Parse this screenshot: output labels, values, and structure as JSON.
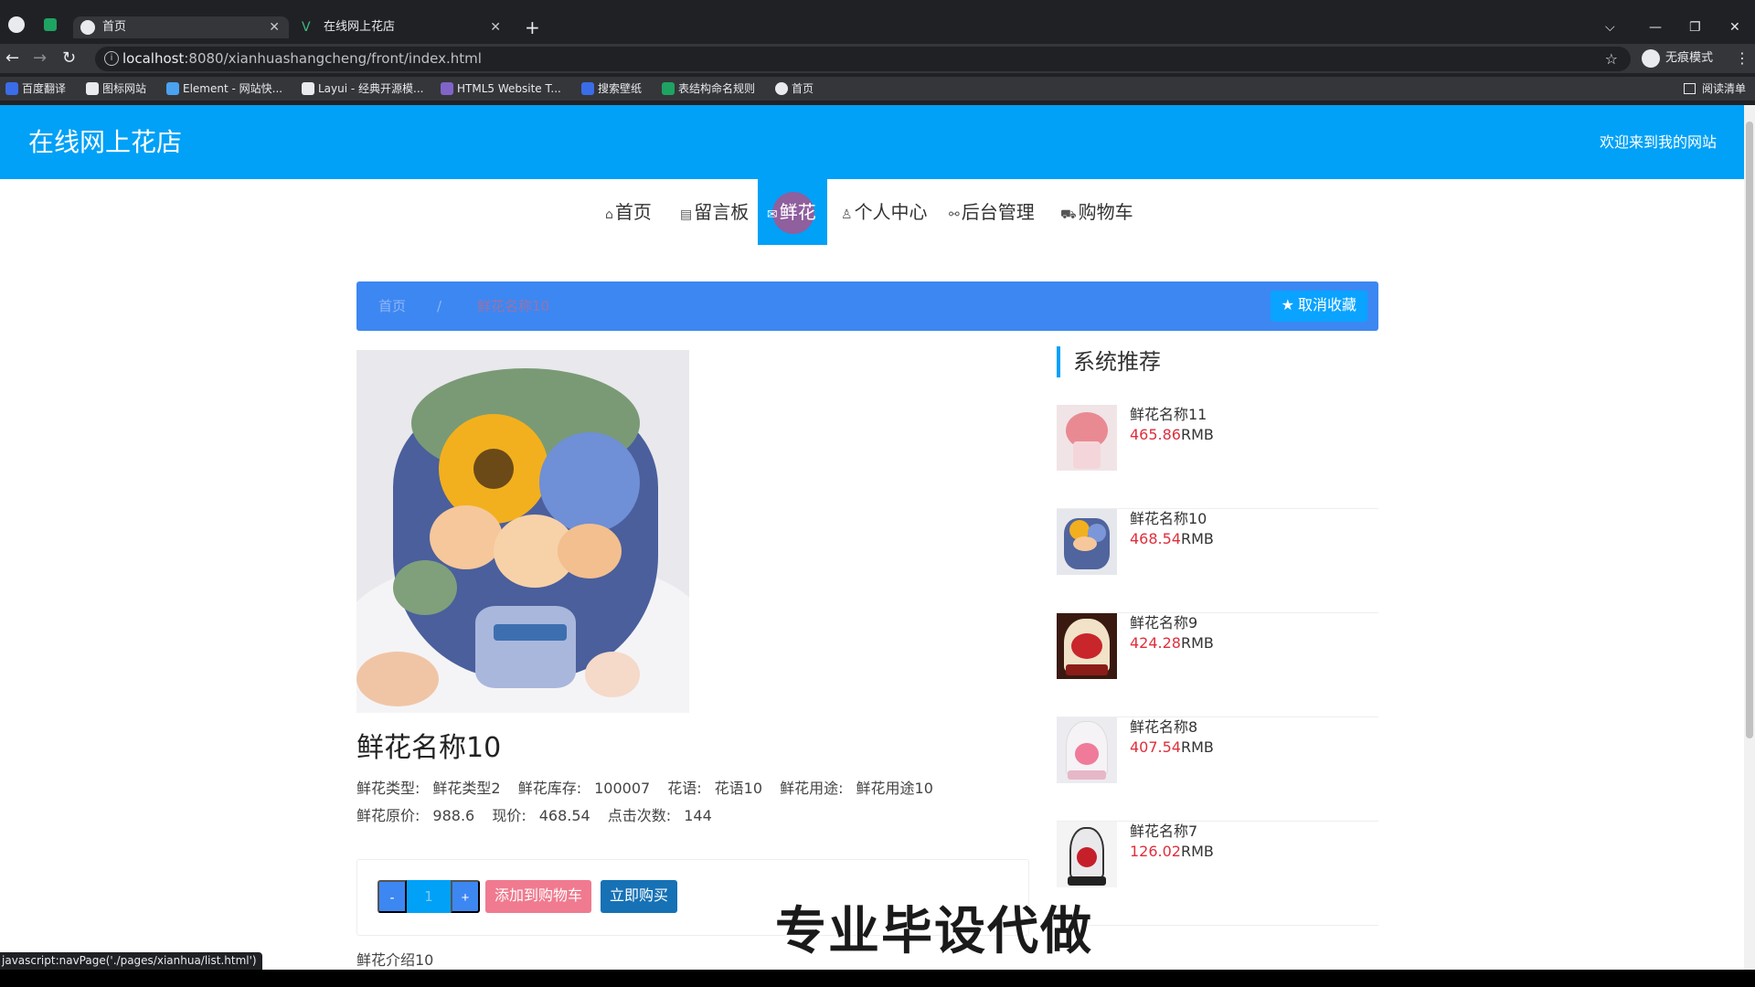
{
  "browser": {
    "tabs": [
      {
        "title": "首页",
        "active": true
      },
      {
        "title": "在线网上花店",
        "active": false
      }
    ],
    "url_host": "localhost",
    "url_rest": ":8080/xianhuashangcheng/front/index.html",
    "incognito_label": "无痕模式",
    "bookmarks": [
      {
        "label": "百度翻译",
        "color": "#3b6de8"
      },
      {
        "label": "图标网站",
        "color": "#e8eaed"
      },
      {
        "label": "Element - 网站快...",
        "color": "#4aa2f0"
      },
      {
        "label": "Layui - 经典开源模...",
        "color": "#e8eaed"
      },
      {
        "label": "HTML5 Website T...",
        "color": "#8064c8"
      },
      {
        "label": "搜索壁纸",
        "color": "#3b6de8"
      },
      {
        "label": "表结构命名规则",
        "color": "#1ea362"
      },
      {
        "label": "首页",
        "color": "#e8eaed"
      }
    ],
    "reading_list": "阅读清单",
    "status_url": "javascript:navPage('./pages/xianhua/list.html')"
  },
  "header": {
    "site_title": "在线网上花店",
    "welcome": "欢迎来到我的网站"
  },
  "nav": [
    {
      "label": "首页",
      "icon": "home-icon",
      "glyph": "⌂"
    },
    {
      "label": "留言板",
      "icon": "message-board-icon",
      "glyph": "▤"
    },
    {
      "label": "鲜花",
      "icon": "flower-icon",
      "glyph": "✉",
      "active": true
    },
    {
      "label": "个人中心",
      "icon": "user-icon",
      "glyph": "♙"
    },
    {
      "label": "后台管理",
      "icon": "link-icon",
      "glyph": "⚯"
    },
    {
      "label": "购物车",
      "icon": "cart-icon",
      "glyph": "⛟"
    }
  ],
  "breadcrumb": {
    "home": "首页",
    "separator": "/",
    "current": "鲜花名称10"
  },
  "unfavorite_label": "取消收藏",
  "product": {
    "name": "鲜花名称10",
    "type_label": "鲜花类型:",
    "type_value": "鲜花类型2",
    "stock_label": "鲜花库存:",
    "stock_value": "100007",
    "language_label": "花语:",
    "language_value": "花语10",
    "usage_label": "鲜花用途:",
    "usage_value": "鲜花用途10",
    "original_price_label": "鲜花原价:",
    "original_price_value": "988.6",
    "current_price_label": "现价:",
    "current_price_value": "468.54",
    "clicks_label": "点击次数:",
    "clicks_value": "144",
    "quantity": "1",
    "minus_label": "-",
    "plus_label": "+",
    "add_cart_label": "添加到购物车",
    "buy_now_label": "立即购买",
    "intro": "鲜花介绍10"
  },
  "sidebar": {
    "title": "系统推荐",
    "items": [
      {
        "name": "鲜花名称11",
        "price": "465.86",
        "unit": "RMB"
      },
      {
        "name": "鲜花名称10",
        "price": "468.54",
        "unit": "RMB"
      },
      {
        "name": "鲜花名称9",
        "price": "424.28",
        "unit": "RMB"
      },
      {
        "name": "鲜花名称8",
        "price": "407.54",
        "unit": "RMB"
      },
      {
        "name": "鲜花名称7",
        "price": "126.02",
        "unit": "RMB"
      }
    ]
  },
  "watermark": "专业毕设代做",
  "colors": {
    "brand": "#00a1f7",
    "breadcrumb_bar": "#3d87f2",
    "price_red": "#e02e3c",
    "add_cart": "#f07a8f",
    "buy_now": "#1671b5"
  }
}
